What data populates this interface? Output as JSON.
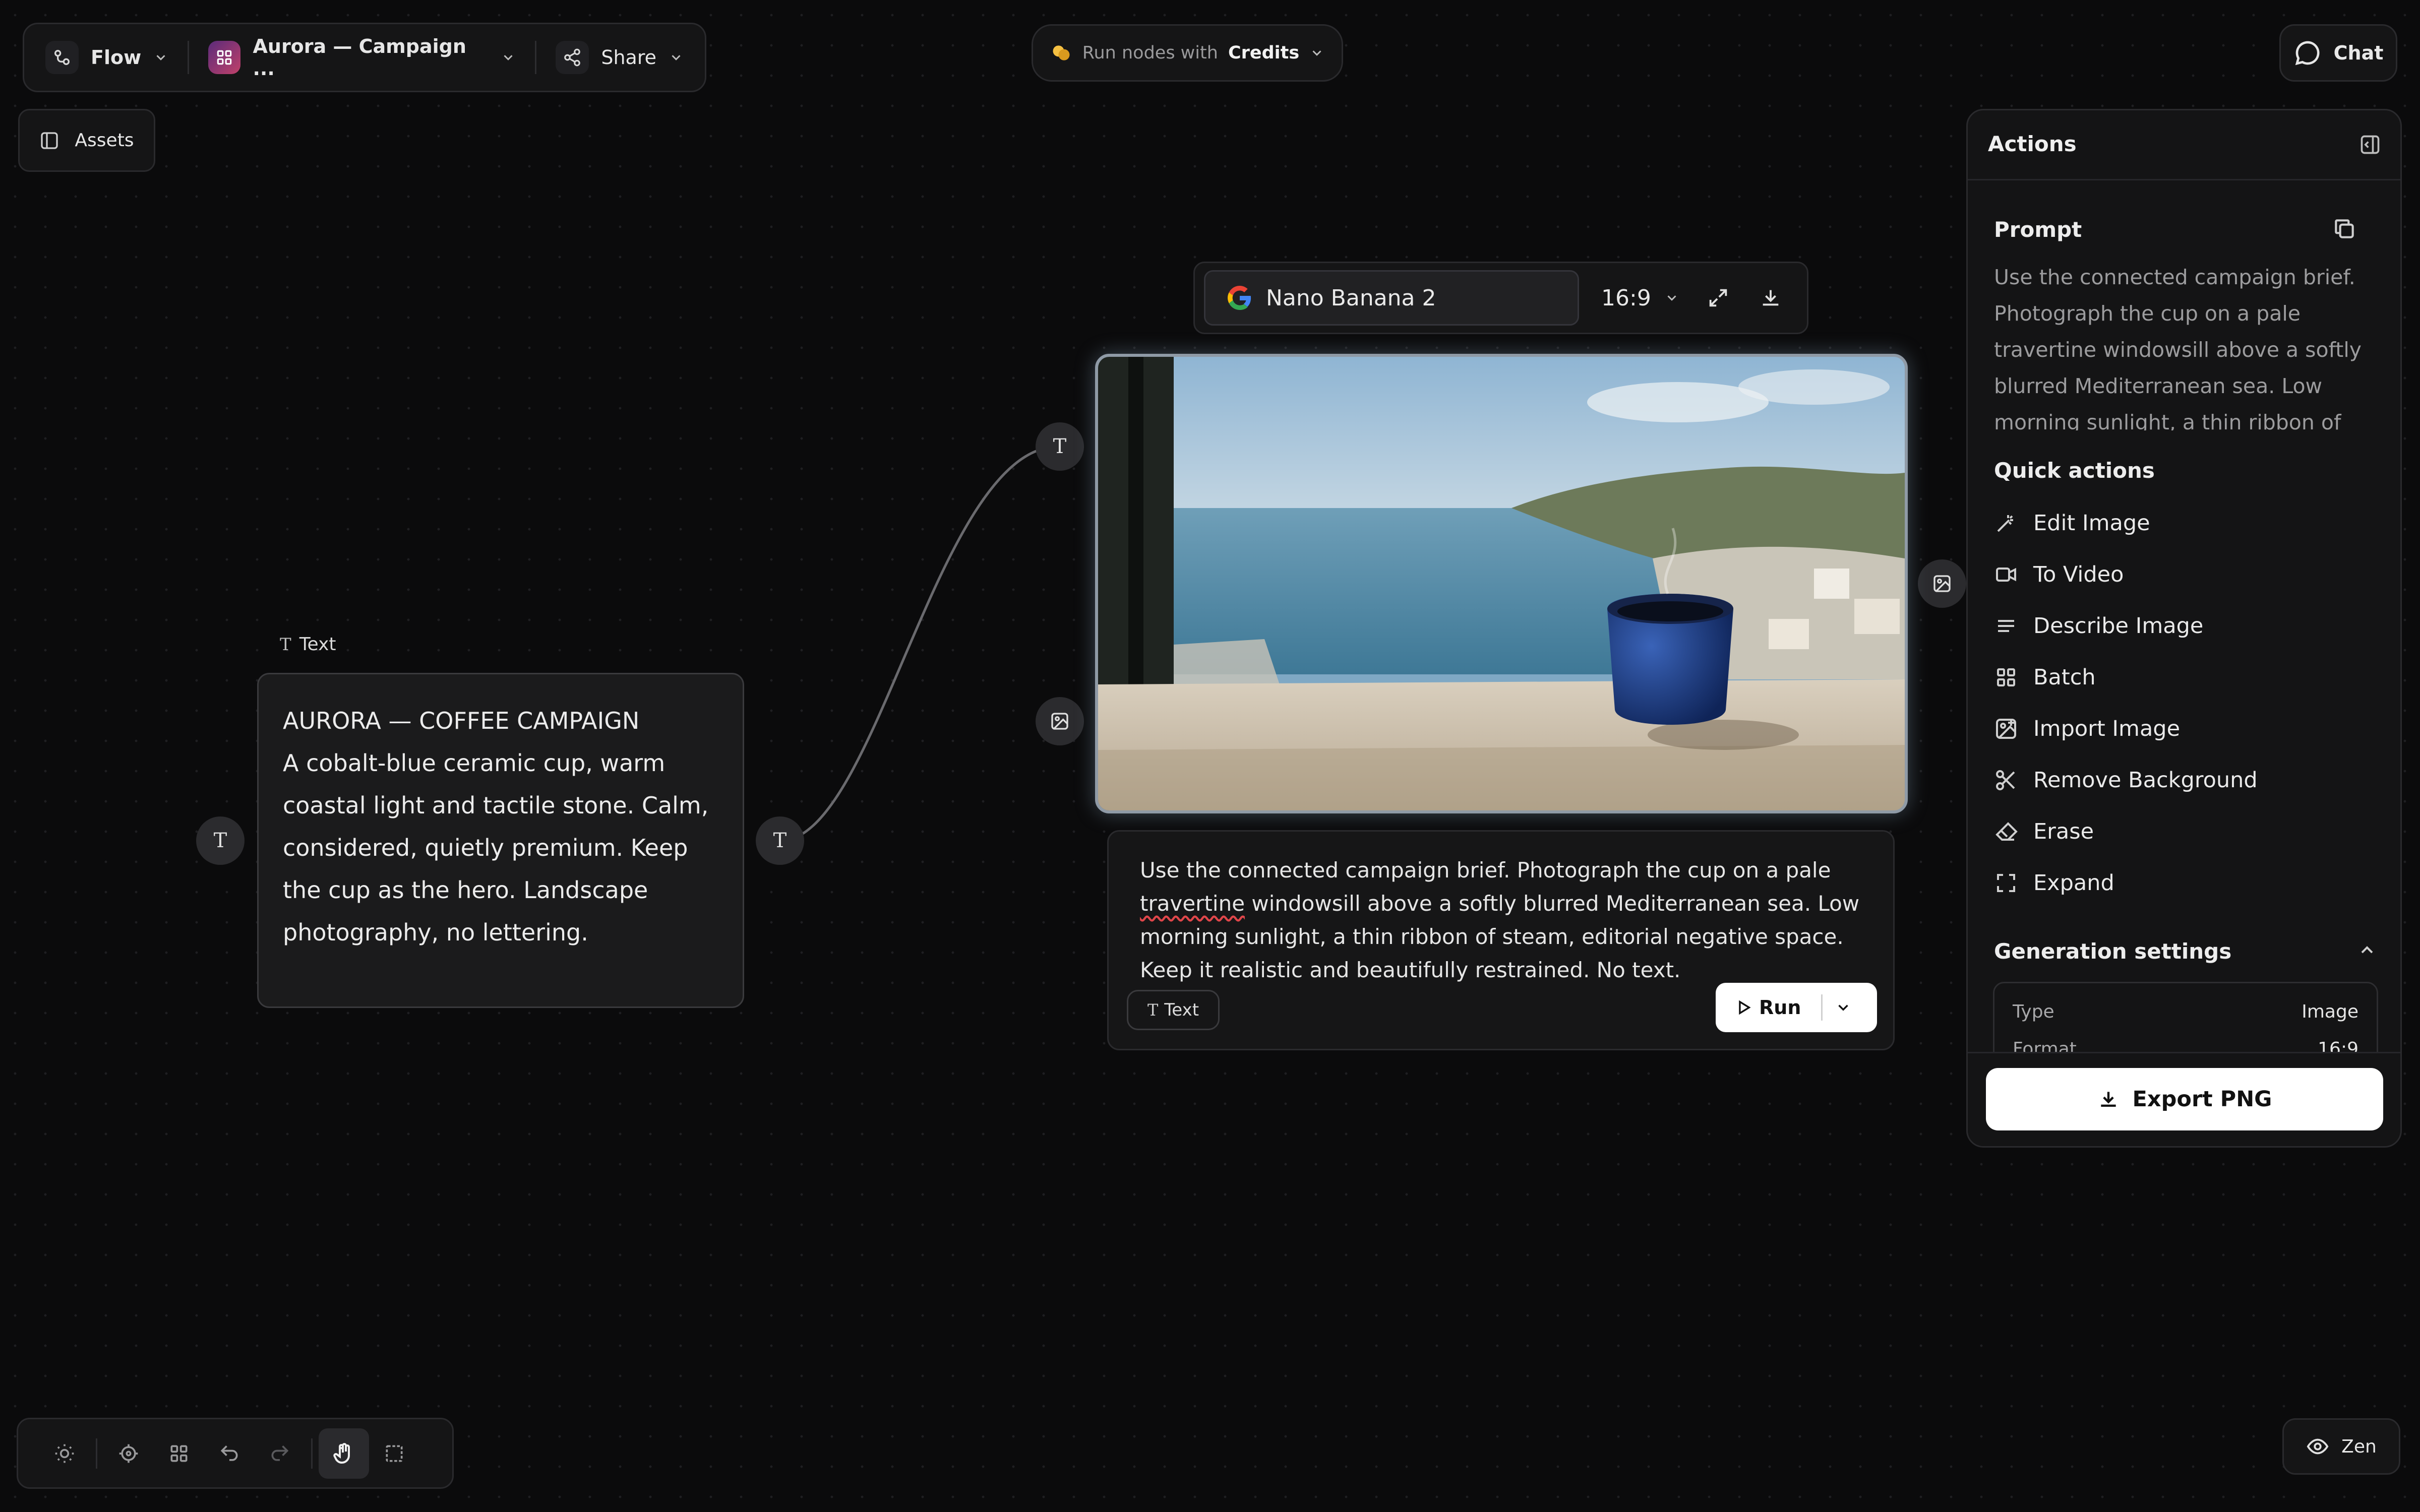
{
  "toolbar": {
    "flow_label": "Flow",
    "project_label": "Aurora — Campaign ...",
    "share_label": "Share"
  },
  "run_credits": {
    "prefix": "Run nodes with",
    "value": "Credits"
  },
  "chat_label": "Chat",
  "assets_label": "Assets",
  "text_node": {
    "label": "Text",
    "title": "AURORA — COFFEE CAMPAIGN",
    "body": "A cobalt-blue ceramic cup, warm coastal light and tactile stone. Calm, considered, quietly premium. Keep the cup as the hero. Landscape photography, no lettering."
  },
  "image_node": {
    "model": "Nano Banana 2",
    "aspect_ratio": "16:9",
    "prompt_before": "Use the connected campaign brief. Photograph the cup on a pale ",
    "prompt_flagged_word": "travertine",
    "prompt_after": " windowsill above a softly blurred Mediterranean sea. Low morning sunlight, a thin ribbon of steam, editorial negative space. Keep it realistic and beautifully restrained. No text.",
    "input_chip": "Text",
    "run_label": "Run"
  },
  "actions_panel": {
    "title": "Actions",
    "prompt_heading": "Prompt",
    "prompt_preview": "Use the connected campaign brief. Photograph the cup on a pale travertine windowsill above a softly blurred Mediterranean sea. Low morning sunlight, a thin ribbon of",
    "quick_actions_heading": "Quick actions",
    "quick_actions": [
      {
        "label": "Edit Image",
        "icon": "magic-wand-icon"
      },
      {
        "label": "To Video",
        "icon": "video-camera-icon"
      },
      {
        "label": "Describe Image",
        "icon": "text-lines-icon"
      },
      {
        "label": "Batch",
        "icon": "grid-icon"
      },
      {
        "label": "Import Image",
        "icon": "image-plus-icon"
      },
      {
        "label": "Remove Background",
        "icon": "scissors-icon"
      },
      {
        "label": "Erase",
        "icon": "eraser-icon"
      },
      {
        "label": "Expand",
        "icon": "expand-icon"
      }
    ],
    "gen_settings_heading": "Generation settings",
    "settings": [
      {
        "key": "Type",
        "value": "Image"
      },
      {
        "key": "Format",
        "value": "16:9"
      }
    ],
    "export_label": "Export PNG"
  },
  "zen_label": "Zen",
  "colors": {
    "canvas": "#0b0b0c",
    "panel": "#151516",
    "accent_white": "#ffffff",
    "credits_coin": "#f5c042",
    "spell_error": "#e0464a"
  }
}
